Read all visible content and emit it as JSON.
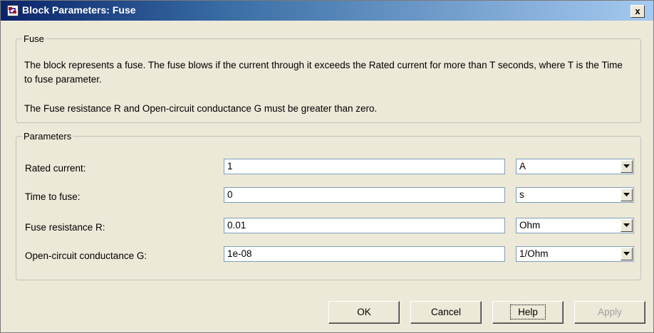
{
  "window": {
    "title": "Block Parameters: Fuse",
    "close_label": "x"
  },
  "fuse_group": {
    "legend": "Fuse",
    "description_1": "The block represents a fuse. The fuse blows if the current through it exceeds the Rated current for more than T seconds, where T is the Time to fuse parameter.",
    "description_2": "The Fuse resistance R and Open-circuit conductance G must be greater than zero."
  },
  "parameters_group": {
    "legend": "Parameters",
    "rows": [
      {
        "label": "Rated current:",
        "value": "1",
        "unit": "A"
      },
      {
        "label": "Time to fuse:",
        "value": "0",
        "unit": "s"
      },
      {
        "label": "Fuse resistance R:",
        "value": "0.01",
        "unit": "Ohm"
      },
      {
        "label": "Open-circuit conductance G:",
        "value": "1e-08",
        "unit": "1/Ohm"
      }
    ]
  },
  "buttons": {
    "ok": "OK",
    "cancel": "Cancel",
    "help": "Help",
    "apply": "Apply"
  },
  "icons": {
    "title_icon": "simulink-block-icon",
    "dropdown_icon": "chevron-down-icon"
  }
}
